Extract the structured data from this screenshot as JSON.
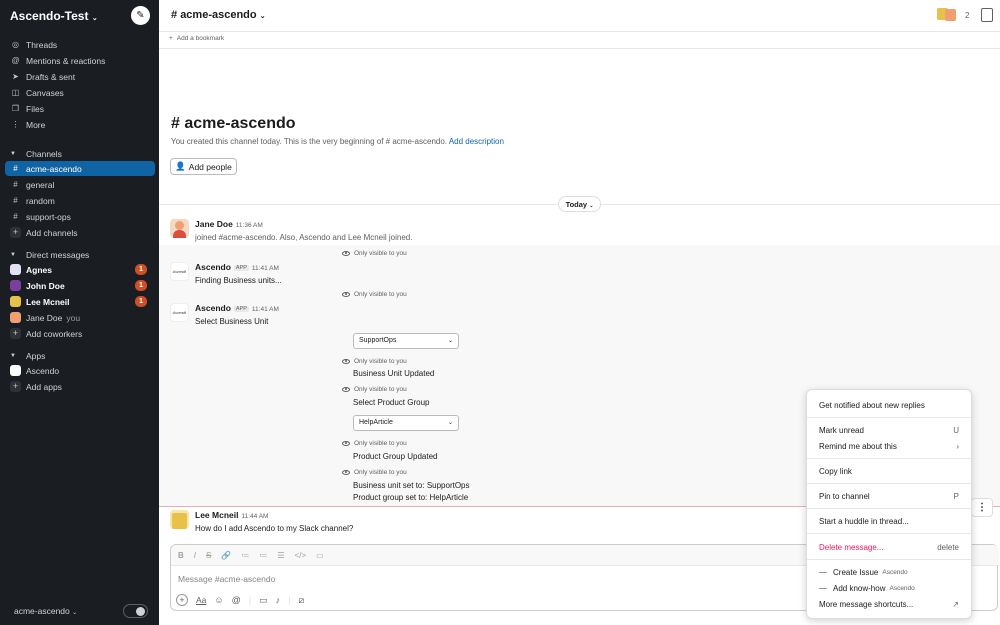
{
  "sidebar": {
    "workspace": "Ascendo-Test",
    "nav": [
      {
        "label": "Threads",
        "icon": "threads-icon"
      },
      {
        "label": "Mentions & reactions",
        "icon": "at-icon"
      },
      {
        "label": "Drafts & sent",
        "icon": "send-icon"
      },
      {
        "label": "Canvases",
        "icon": "canvas-icon"
      },
      {
        "label": "Files",
        "icon": "files-icon"
      },
      {
        "label": "More",
        "icon": "more-icon"
      }
    ],
    "channels_header": "Channels",
    "channels": [
      "acme-ascendo",
      "general",
      "random",
      "support-ops"
    ],
    "add_channels": "Add channels",
    "dm_header": "Direct messages",
    "dms": [
      {
        "name": "Agnes",
        "badge": "1"
      },
      {
        "name": "John Doe",
        "badge": "1"
      },
      {
        "name": "Lee Mcneil",
        "badge": "1"
      },
      {
        "name": "Jane Doe",
        "suffix": "you"
      }
    ],
    "add_coworkers": "Add coworkers",
    "apps_header": "Apps",
    "apps": [
      "Ascendo"
    ],
    "add_apps": "Add apps",
    "footer_workspace": "acme-ascendo"
  },
  "header": {
    "channel": "acme-ascendo",
    "member_count": "2",
    "bookmark": "Add a bookmark"
  },
  "intro": {
    "title": "acme-ascendo",
    "text": "You created this channel today. This is the very beginning of # acme-ascendo.",
    "link": "Add description",
    "add_people": "Add people"
  },
  "today": "Today",
  "messages": {
    "jane": {
      "name": "Jane Doe",
      "time": "11:36 AM",
      "text": "joined #acme-ascendo. Also, Ascendo and Lee Mcneil joined."
    },
    "only_visible": "Only visible to you",
    "bot1": {
      "name": "Ascendo",
      "tag": "APP",
      "time": "11:41 AM",
      "text": "Finding Business units..."
    },
    "bot2": {
      "name": "Ascendo",
      "tag": "APP",
      "time": "11:41 AM",
      "text": "Select Business Unit"
    },
    "select_bu": "SupportOps",
    "bu_updated": "Business Unit Updated",
    "select_pg_label": "Select Product Group",
    "select_pg": "HelpArticle",
    "pg_updated": "Product Group Updated",
    "summary1": "Business unit set to: SupportOps",
    "summary2": "Product group set to: HelpArticle",
    "logo_text": "Ascend∂",
    "lee": {
      "name": "Lee Mcneil",
      "time": "11:44 AM",
      "text": "How do I add Ascendo to my Slack channel?"
    }
  },
  "composer": {
    "placeholder": "Message #acme-ascendo",
    "format_buttons": [
      "B",
      "I",
      "S",
      "🔗",
      "≔",
      "≔",
      "☰",
      "</>",
      "▭"
    ]
  },
  "menu": {
    "notify": "Get notified about new replies",
    "mark_unread": "Mark unread",
    "mark_unread_sc": "U",
    "remind": "Remind me about this",
    "copy_link": "Copy link",
    "pin": "Pin to channel",
    "pin_sc": "P",
    "huddle": "Start a huddle in thread...",
    "delete": "Delete message...",
    "delete_sc": "delete",
    "create_issue": "Create Issue",
    "add_know_how": "Add know-how",
    "app_name": "Ascendo",
    "more_shortcuts": "More message shortcuts..."
  },
  "colors": {
    "sidebar_bg": "#1a1d21",
    "active_channel": "#1164a3",
    "badge": "#cd4f25",
    "danger": "#e01e5a",
    "link": "#1264a3"
  }
}
